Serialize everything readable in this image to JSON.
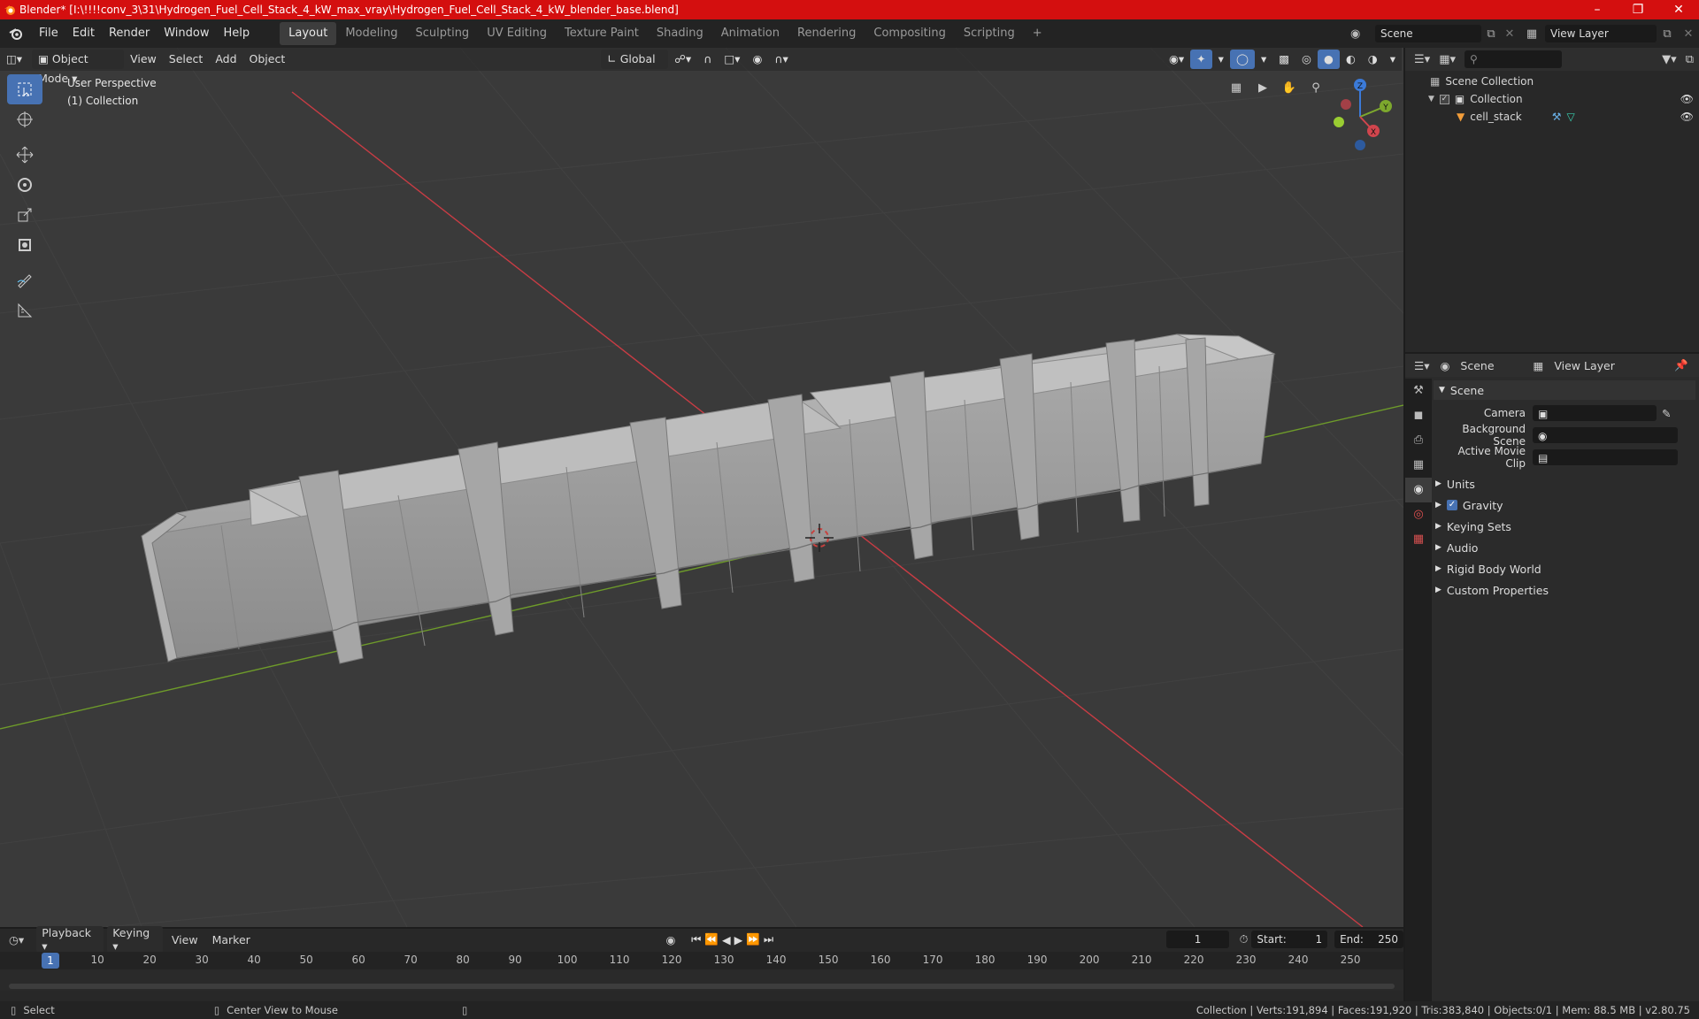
{
  "window": {
    "title": "Blender* [I:\\!!!!conv_3\\31\\Hydrogen_Fuel_Cell_Stack_4_kW_max_vray\\Hydrogen_Fuel_Cell_Stack_4_kW_blender_base.blend]",
    "controls": [
      "minimize",
      "maximize",
      "close"
    ]
  },
  "menu": [
    "File",
    "Edit",
    "Render",
    "Window",
    "Help"
  ],
  "workspaces": [
    "Layout",
    "Modeling",
    "Sculpting",
    "UV Editing",
    "Texture Paint",
    "Shading",
    "Animation",
    "Rendering",
    "Compositing",
    "Scripting"
  ],
  "active_workspace": "Layout",
  "scene_field": "Scene",
  "view_layer_field": "View Layer",
  "viewport_header": {
    "mode": "Object Mode",
    "menus": [
      "View",
      "Select",
      "Add",
      "Object"
    ],
    "orientation": "Global"
  },
  "viewport": {
    "info_line1": "User Perspective",
    "info_line2": "(1) Collection",
    "axes": [
      "Z",
      "Y",
      "X"
    ]
  },
  "outliner": {
    "root": "Scene Collection",
    "collection": "Collection",
    "object": "cell_stack"
  },
  "properties": {
    "tab_scene": "Scene",
    "tab_view_layer": "View Layer",
    "section": "Scene",
    "camera_label": "Camera",
    "background_scene_label": "Background Scene",
    "active_movie_clip_label": "Active Movie Clip",
    "subpanels": [
      "Units",
      "Gravity",
      "Keying Sets",
      "Audio",
      "Rigid Body World",
      "Custom Properties"
    ],
    "gravity_checked": true
  },
  "timeline": {
    "menus": [
      "Playback",
      "Keying",
      "View",
      "Marker"
    ],
    "current_frame": "1",
    "start_label": "Start:",
    "start_value": "1",
    "end_label": "End:",
    "end_value": "250",
    "ticks": [
      "10",
      "20",
      "30",
      "40",
      "50",
      "60",
      "70",
      "80",
      "90",
      "100",
      "110",
      "120",
      "130",
      "140",
      "150",
      "160",
      "170",
      "180",
      "190",
      "200",
      "210",
      "220",
      "230",
      "240",
      "250"
    ],
    "frame_marker": "1"
  },
  "statusbar": {
    "left": "Select",
    "middle": "Center View to Mouse",
    "right": "Collection | Verts:191,894 | Faces:191,920 | Tris:383,840 | Objects:0/1 | Mem: 88.5 MB | v2.80.75"
  },
  "colors": {
    "accent": "#4772b3",
    "titlebar": "#d40f0f",
    "viewport_bg": "#3a3a3a",
    "x_axis": "#d1454d",
    "y_axis": "#7da82d",
    "z_axis": "#3b7ad8"
  }
}
